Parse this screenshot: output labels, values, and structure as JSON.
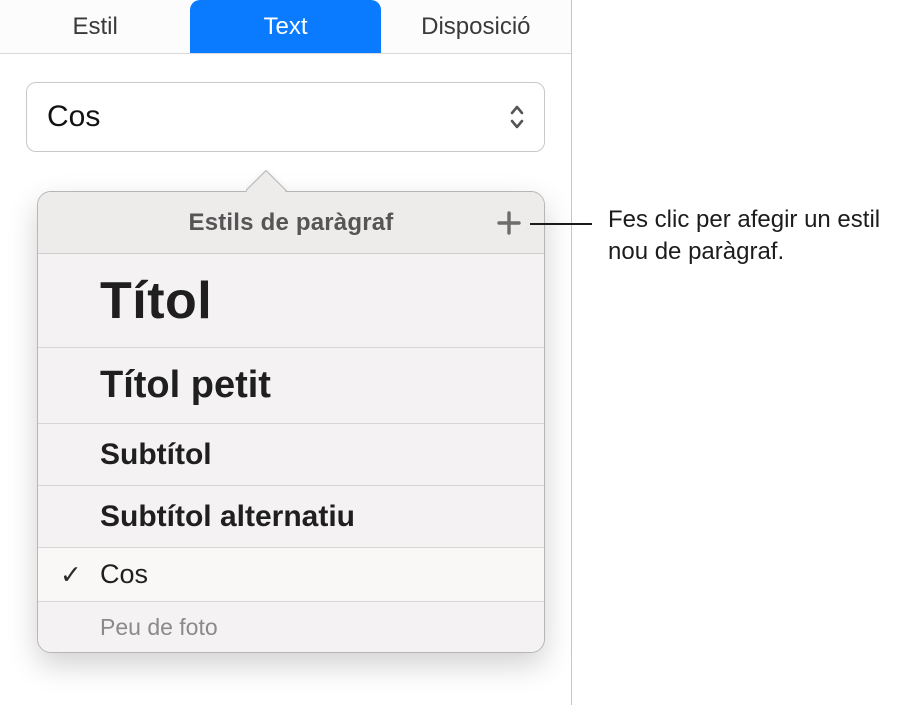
{
  "tabs": {
    "style": "Estil",
    "text": "Text",
    "layout": "Disposició"
  },
  "paragraph_style_select": {
    "current": "Cos"
  },
  "popover": {
    "title": "Estils de paràgraf",
    "items": [
      {
        "label": "Títol"
      },
      {
        "label": "Títol petit"
      },
      {
        "label": "Subtítol"
      },
      {
        "label": "Subtítol alternatiu"
      },
      {
        "label": "Cos",
        "selected": true
      },
      {
        "label": "Peu de foto"
      }
    ]
  },
  "callout": {
    "text": "Fes clic per afegir un estil nou de paràgraf."
  }
}
